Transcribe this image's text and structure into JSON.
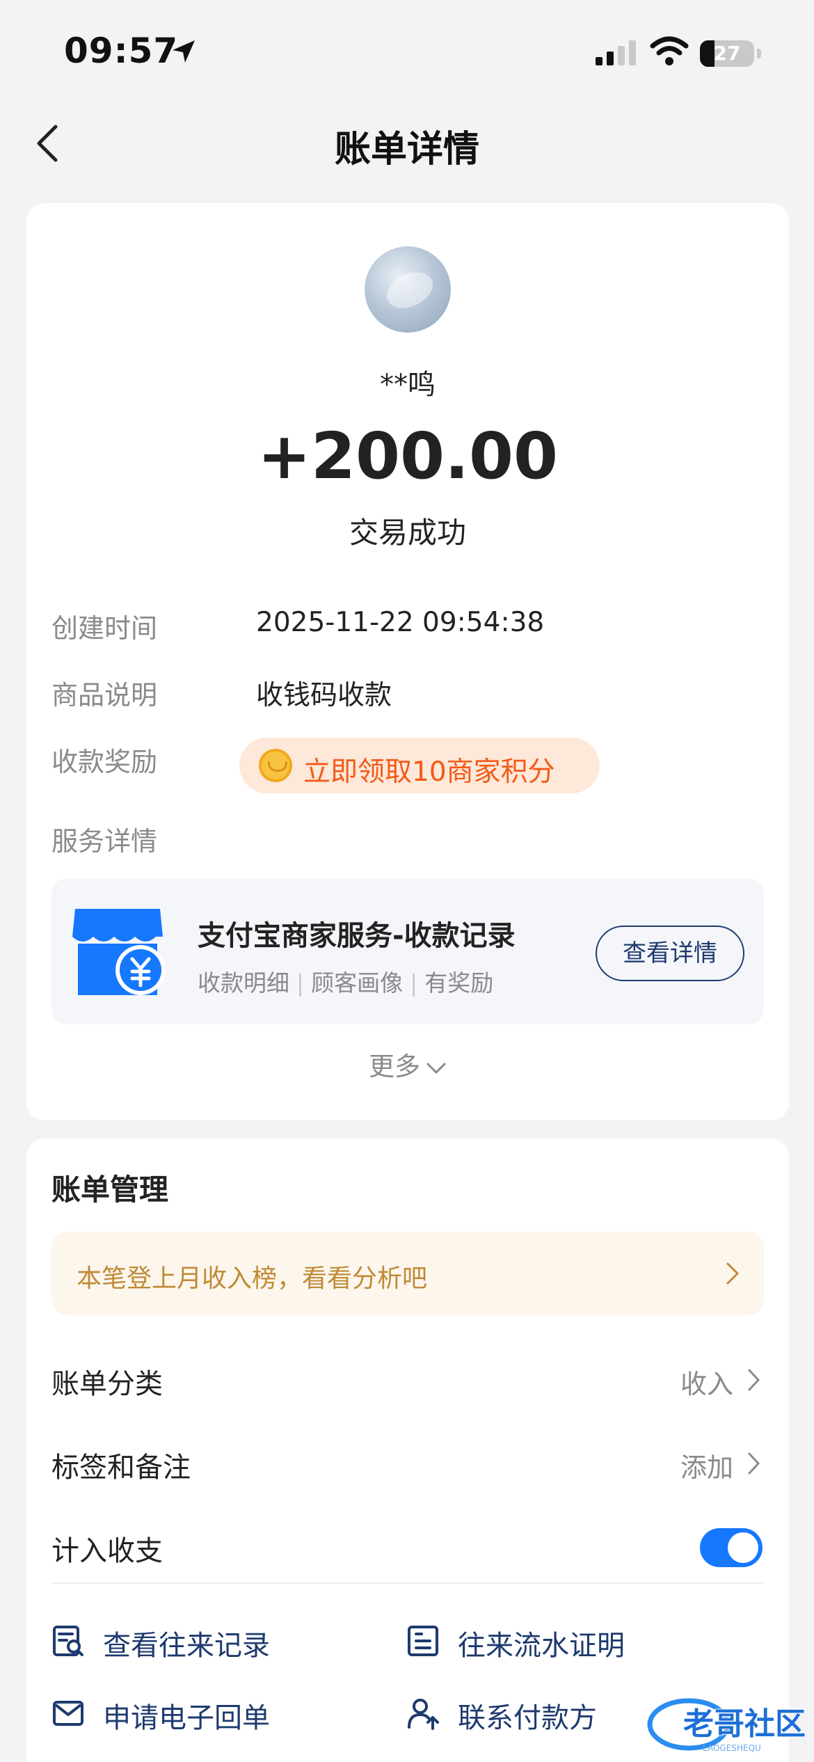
{
  "status_bar": {
    "time": "09:57",
    "battery": "27"
  },
  "nav": {
    "title": "账单详情"
  },
  "payer": {
    "name": "**鸣",
    "amount": "+200.00",
    "status": "交易成功"
  },
  "details": [
    {
      "label": "创建时间",
      "value": "2025-11-22 09:54:38"
    },
    {
      "label": "商品说明",
      "value": "收钱码收款"
    },
    {
      "label": "收款奖励",
      "value": "立即领取10商家积分"
    },
    {
      "label": "服务详情"
    }
  ],
  "service": {
    "title": "支付宝商家服务-收款记录",
    "tags": [
      "收款明细",
      "顾客画像",
      "有奖励"
    ],
    "button": "查看详情",
    "more": "更多"
  },
  "management": {
    "title": "账单管理",
    "notice": "本笔登上月收入榜，看看分析吧",
    "category_label": "账单分类",
    "category_value": "收入",
    "tags_label": "标签和备注",
    "tags_value": "添加",
    "count_label": "计入收支",
    "count_enabled": true,
    "actions": [
      "查看往来记录",
      "往来流水证明",
      "申请电子回单",
      "联系付款方"
    ]
  },
  "watermark": {
    "text": "老哥社区",
    "sub": "LAOGESHEQU"
  },
  "colors": {
    "accent": "#1677ff",
    "reward": "#f25a17",
    "notice": "#c08a36",
    "link": "#1e3a6e"
  }
}
